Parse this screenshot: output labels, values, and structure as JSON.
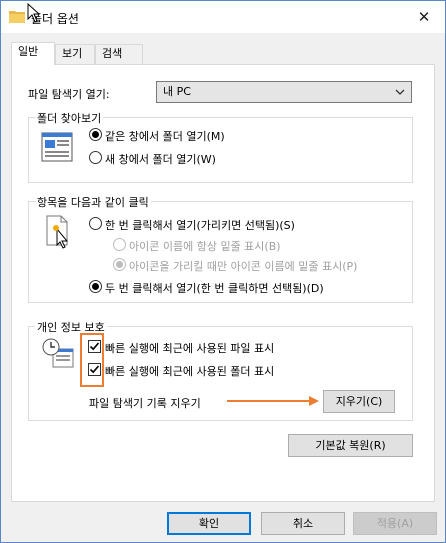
{
  "window": {
    "title": "폴더 옵션",
    "close_glyph": "✕"
  },
  "tabs": [
    {
      "label": "일반",
      "active": true
    },
    {
      "label": "보기",
      "active": false
    },
    {
      "label": "검색",
      "active": false
    }
  ],
  "general": {
    "open_explorer_label": "파일 탐색기 열기:",
    "open_explorer_value": "내 PC",
    "browse_group": {
      "title": "폴더 찾아보기",
      "options": [
        {
          "label": "같은 창에서 폴더 열기(M)",
          "checked": true
        },
        {
          "label": "새 창에서 폴더 열기(W)",
          "checked": false
        }
      ]
    },
    "click_group": {
      "title": "항목을 다음과 같이 클릭",
      "options": [
        {
          "label": "한 번 클릭해서 열기(가리키면 선택됨)(S)",
          "checked": false,
          "enabled": true
        },
        {
          "label": "아이콘 이름에 항상 밑줄 표시(B)",
          "checked": false,
          "enabled": false
        },
        {
          "label": "아이콘을 가리킬 때만 아이콘 이름에 밑줄 표시(P)",
          "checked": true,
          "enabled": false
        },
        {
          "label": "두 번 클릭해서 열기(한 번 클릭하면 선택됨)(D)",
          "checked": true,
          "enabled": true
        }
      ]
    },
    "privacy_group": {
      "title": "개인 정보 보호",
      "checks": [
        {
          "label": "빠른 실행에 최근에 사용된 파일 표시",
          "checked": true
        },
        {
          "label": "빠른 실행에 최근에 사용된 폴더 표시",
          "checked": true
        }
      ],
      "clear_label": "파일 탐색기 기록 지우기",
      "clear_button": "지우기(C)"
    },
    "restore_button": "기본값 복원(R)"
  },
  "footer": {
    "ok": "확인",
    "cancel": "취소",
    "apply": "적용(A)"
  },
  "colors": {
    "annotation": "#ed7d31",
    "accent": "#0078d7"
  }
}
